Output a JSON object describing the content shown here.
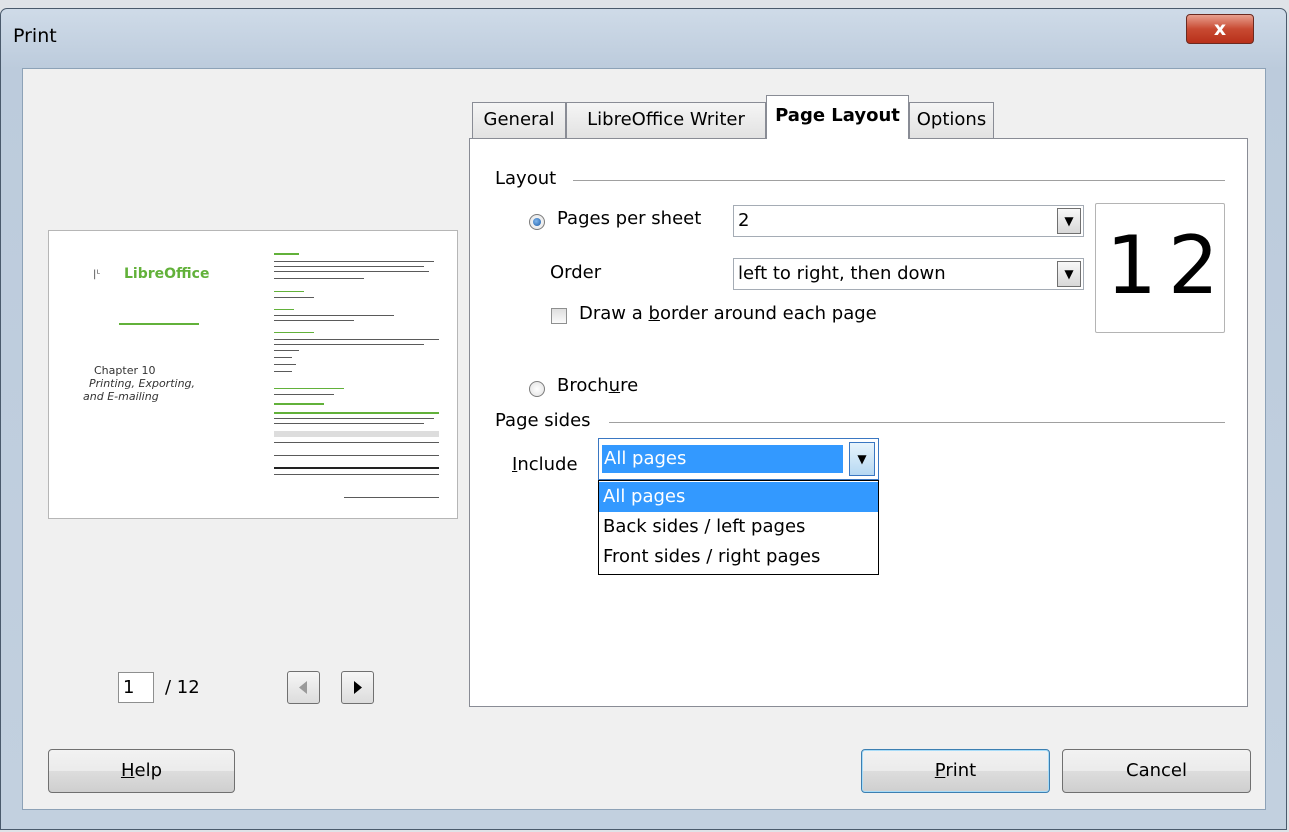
{
  "window": {
    "title": "Print",
    "close_glyph": "x"
  },
  "preview": {
    "page_current": "1",
    "page_total": "/ 12",
    "doc_logo": "LibreOffice",
    "doc_heading": "Chapter 10",
    "doc_subtitle_1": "Printing, Exporting,",
    "doc_subtitle_2": "and E-mailing"
  },
  "tabs": [
    {
      "label": "General"
    },
    {
      "label": "LibreOffice Writer"
    },
    {
      "label": "Page Layout",
      "active": true
    },
    {
      "label": "Options"
    }
  ],
  "layout": {
    "group_label": "Layout",
    "pages_per_sheet_label": "Pages per sheet",
    "pages_per_sheet_value": "2",
    "order_label": "Order",
    "order_value": "left to right, then down",
    "border_label_pre": "Draw a ",
    "border_label_ul": "b",
    "border_label_post": "order around each page",
    "border_checked": false,
    "brochure_pre": "Broch",
    "brochure_ul": "u",
    "brochure_post": "re",
    "preview_left": "1",
    "preview_right": "2"
  },
  "page_sides": {
    "group_label": "Page sides",
    "include_ul": "I",
    "include_rest": "nclude",
    "include_value": "All pages",
    "options": [
      "All pages",
      "Back sides / left pages",
      "Front sides / right pages"
    ],
    "selected_index": 0
  },
  "buttons": {
    "help_ul": "H",
    "help_rest": "elp",
    "print_ul": "P",
    "print_rest": "rint",
    "cancel": "Cancel"
  },
  "colors": {
    "selection": "#3399ff",
    "title_close": "#c84a32",
    "doc_green": "#62b13a"
  }
}
